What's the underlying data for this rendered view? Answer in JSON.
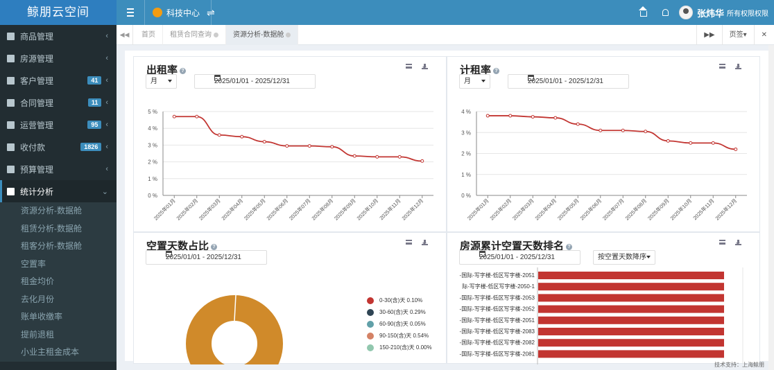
{
  "app": {
    "title": "鲸朋云空间"
  },
  "topbar": {
    "center_label": "科技中心",
    "user_name": "张炜华",
    "user_role": "所有权限权限"
  },
  "sidebar": {
    "items": [
      {
        "label": "商品管理",
        "badge": ""
      },
      {
        "label": "房源管理",
        "badge": ""
      },
      {
        "label": "客户管理",
        "badge": "41"
      },
      {
        "label": "合同管理",
        "badge": "11"
      },
      {
        "label": "运营管理",
        "badge": "95"
      },
      {
        "label": "收付款",
        "badge": "1826"
      },
      {
        "label": "预算管理",
        "badge": ""
      },
      {
        "label": "统计分析",
        "badge": ""
      }
    ],
    "subitems": [
      "资源分析-数据舱",
      "租赁分析-数据舱",
      "租客分析-数据舱",
      "空置率",
      "租金均价",
      "去化月份",
      "账单收缴率",
      "提前退租",
      "小业主租金成本"
    ]
  },
  "tabs": {
    "items": [
      {
        "label": "首页"
      },
      {
        "label": "租赁合同查询"
      },
      {
        "label": "资源分析-数据舱"
      }
    ],
    "page_ops": "页签▾"
  },
  "panels": {
    "occupancy": {
      "title": "出租率",
      "period": "月",
      "date_range": "2025/01/01 - 2025/12/31"
    },
    "billing": {
      "title": "计租率",
      "period": "月",
      "date_range": "2025/01/01 - 2025/12/31"
    },
    "vacancy_ratio": {
      "title": "空置天数占比",
      "date_range": "2025/01/01 - 2025/12/31"
    },
    "vacancy_rank": {
      "title": "房源累计空置天数排名",
      "date_range": "2025/01/01 - 2025/12/31",
      "sort": "按空置天数降序"
    }
  },
  "footer": {
    "text": "技术支持：上海鲸朋"
  },
  "colors": {
    "line": "#c23531",
    "bar": "#c23531",
    "donut": "#d08a2a"
  },
  "chart_data": [
    {
      "type": "line",
      "title": "出租率",
      "categories": [
        "2025年01月",
        "2025年02月",
        "2025年03月",
        "2025年04月",
        "2025年05月",
        "2025年06月",
        "2025年07月",
        "2025年08月",
        "2025年09月",
        "2025年10月",
        "2025年11月",
        "2025年12月"
      ],
      "values": [
        4.7,
        4.7,
        3.6,
        3.5,
        3.2,
        2.95,
        2.95,
        2.9,
        2.35,
        2.3,
        2.3,
        2.05
      ],
      "yticks": [
        "0 %",
        "1 %",
        "2 %",
        "3 %",
        "4 %",
        "5 %"
      ],
      "ylim": [
        0,
        5
      ]
    },
    {
      "type": "line",
      "title": "计租率",
      "categories": [
        "2025年01月",
        "2025年02月",
        "2025年03月",
        "2025年04月",
        "2025年05月",
        "2025年06月",
        "2025年07月",
        "2025年08月",
        "2025年09月",
        "2025年10月",
        "2025年11月",
        "2025年12月"
      ],
      "values": [
        3.8,
        3.8,
        3.75,
        3.7,
        3.4,
        3.1,
        3.1,
        3.05,
        2.6,
        2.5,
        2.5,
        2.2
      ],
      "yticks": [
        "0 %",
        "1 %",
        "2 %",
        "3 %",
        "4 %"
      ],
      "ylim": [
        0,
        4
      ]
    },
    {
      "type": "pie",
      "title": "空置天数占比",
      "legend": [
        {
          "name": "0-30(含)天",
          "value": "0.10%",
          "color": "#c23531"
        },
        {
          "name": "30-60(含)天",
          "value": "0.29%",
          "color": "#2f4554"
        },
        {
          "name": "60-90(含)天",
          "value": "0.05%",
          "color": "#61a0a8"
        },
        {
          "name": "90-150(含)天",
          "value": "0.54%",
          "color": "#d48265"
        },
        {
          "name": "150-210(含)天",
          "value": "0.00%",
          "color": "#91c7ae"
        }
      ]
    },
    {
      "type": "bar",
      "title": "房源累计空置天数排名",
      "categories": [
        "-国际-写字楼-低区写字楼-2051",
        "际-写字楼-低区写字楼-2050-1",
        "-国际-写字楼-低区写字楼-2053",
        "-国际-写字楼-低区写字楼-2052",
        "-国际-写字楼-低区写字楼-2051",
        "-国际-写字楼-低区写字楼-2083",
        "-国际-写字楼-低区写字楼-2082",
        "-国际-写字楼-低区写字楼-2081"
      ]
    }
  ]
}
